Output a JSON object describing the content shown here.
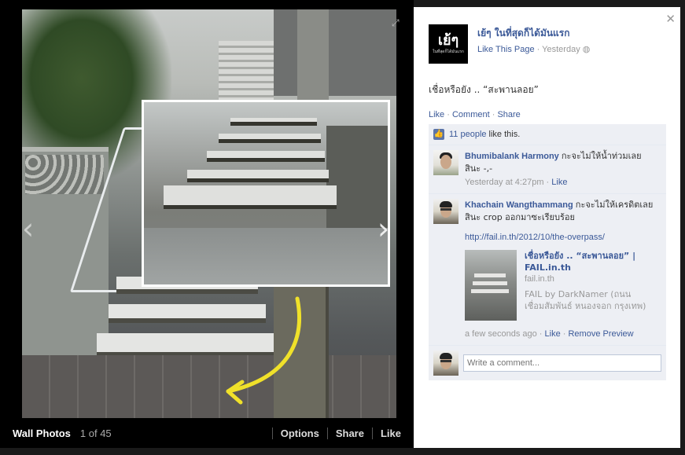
{
  "viewer": {
    "album_name": "Wall Photos",
    "position": "1 of 45",
    "buttons": {
      "options": "Options",
      "share": "Share",
      "like": "Like"
    },
    "prev_icon": "chevron-left-icon",
    "next_icon": "chevron-right-icon"
  },
  "post": {
    "page_name": "เย้ๆ ในที่สุดก็ได้มันแรก",
    "avatar_text": "เย้ๆ",
    "avatar_subtext": "ในที่สุดก็ได้มันแรก",
    "like_page": "Like This Page",
    "time": "Yesterday",
    "caption": "เชื่อหรือยัง .. “สะพานลอย”",
    "actions": {
      "like": "Like",
      "comment": "Comment",
      "share": "Share"
    }
  },
  "likes": {
    "count_text": "11 people",
    "suffix": "like this."
  },
  "comments": [
    {
      "author": "Bhumibalank Harmony",
      "text": "กะจะไม่ให้น้ำท่วมเลยสินะ -,-",
      "time": "Yesterday at 4:27pm",
      "like": "Like"
    },
    {
      "author": "Khachain Wangthammang",
      "text": "กะจะไม่ให้เครดิตเลยสินะ crop ออกมาซะเรียบร้อย",
      "url": "http://fail.in.th/2012/10/the-overpass/",
      "share_title": "เชื่อหรือยัง .. “สะพานลอย” | FAIL.in.th",
      "share_domain": "fail.in.th",
      "share_desc": "FAIL by DarkNamer (ถนนเชื่อมสัมพันธ์ หนองจอก กรุงเทพ)",
      "time": "a few seconds ago",
      "like": "Like",
      "remove": "Remove Preview"
    }
  ],
  "composer": {
    "placeholder": "Write a comment..."
  }
}
